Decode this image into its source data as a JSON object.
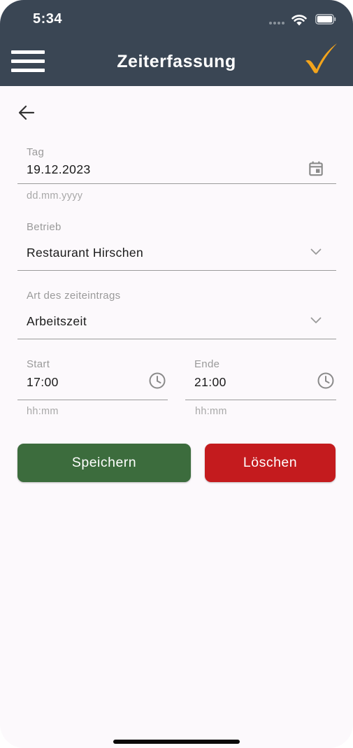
{
  "status_bar": {
    "time": "5:34"
  },
  "header": {
    "title": "Zeiterfassung"
  },
  "form": {
    "day": {
      "label": "Tag",
      "value": "19.12.2023",
      "hint": "dd.mm.yyyy"
    },
    "business": {
      "label": "Betrieb",
      "value": "Restaurant Hirschen"
    },
    "entry_type": {
      "label": "Art des zeiteintrags",
      "value": "Arbeitszeit"
    },
    "start": {
      "label": "Start",
      "value": "17:00",
      "hint": "hh:mm"
    },
    "end": {
      "label": "Ende",
      "value": "21:00",
      "hint": "hh:mm"
    }
  },
  "buttons": {
    "save_label": "Speichern",
    "delete_label": "Löschen"
  },
  "colors": {
    "header_bg": "#3a4654",
    "check_accent": "#f2a41c",
    "save_button": "#3c6c3d",
    "delete_button": "#c41b1e"
  },
  "icons": {
    "menu": "hamburger-icon",
    "confirm": "checkmark-icon",
    "back": "arrow-left-icon",
    "date_picker": "calendar-icon",
    "dropdown": "chevron-down-icon",
    "time_picker": "clock-icon"
  }
}
